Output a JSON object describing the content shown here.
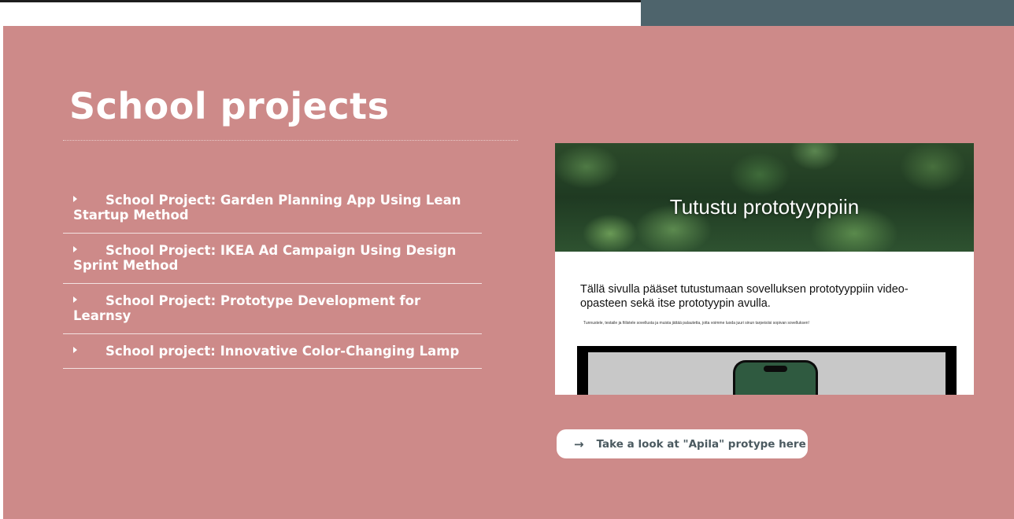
{
  "page": {
    "title": "School projects",
    "accent_color": "#cd8a89",
    "header_dark_color": "#4e646c"
  },
  "projects": [
    {
      "label": "School Project: Garden Planning App Using Lean Startup Method"
    },
    {
      "label": "School Project: IKEA Ad Campaign Using Design Sprint Method"
    },
    {
      "label": "School Project: Prototype Development for Learnsy"
    },
    {
      "label": "School project: Innovative Color-Changing Lamp"
    }
  ],
  "preview": {
    "hero_title": "Tutustu prototyyppiin",
    "heading": "Tällä sivulla pääset tutustumaan sovelluksen prototyyppiin video-opasteen sekä itse prototyypin avulla.",
    "small_text": "Tunnustele, testaile ja fiilistele sovellusta ja muista jättää palautetta, jotta voimme luoda juuri sinun tarpeisiisi sopivan sovelluksen!"
  },
  "cta": {
    "arrow_icon": "arrow-right-icon",
    "label": "Take a look at \"Apila\" protype here"
  }
}
